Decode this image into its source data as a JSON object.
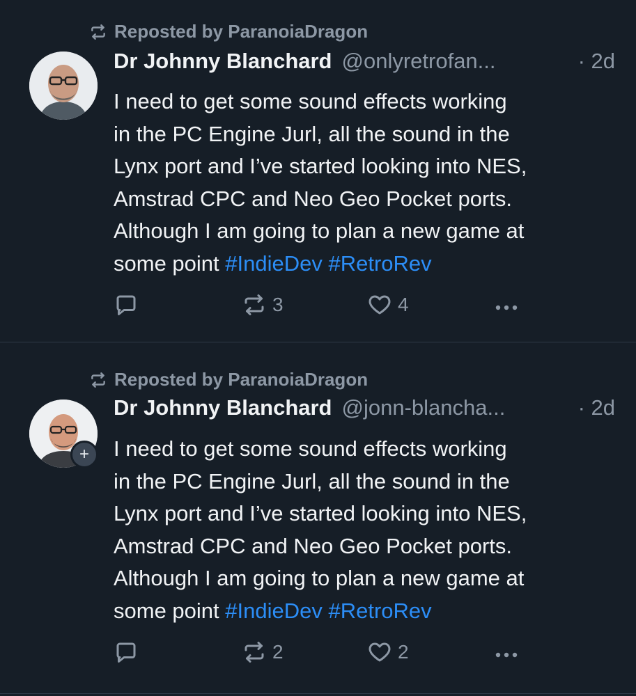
{
  "posts": [
    {
      "repost_label": "Reposted by ParanoiaDragon",
      "author": "Dr Johnny Blanchard",
      "handle": "@onlyretrofan...",
      "time": "· 2d",
      "text_lines": [
        "I need to get some sound effects working",
        "in the PC Engine Jurl, all the sound in the",
        "Lynx port and I’ve started looking into NES,",
        "Amstrad CPC and Neo Geo Pocket ports.",
        "Although I am going to plan a new game at",
        "some point "
      ],
      "hashtags": [
        "#IndieDev",
        "#RetroRev"
      ],
      "repost_count": "3",
      "like_count": "4",
      "follow_badge": ""
    },
    {
      "repost_label": "Reposted by ParanoiaDragon",
      "author": "Dr Johnny Blanchard",
      "handle": "@jonn-blancha...",
      "time": "· 2d",
      "text_lines": [
        "I need to get some sound effects working",
        "in the PC Engine Jurl, all the sound in the",
        "Lynx port and I’ve started looking into NES,",
        "Amstrad CPC and Neo Geo Pocket ports.",
        "Although I am going to plan a new game at",
        "some point "
      ],
      "hashtags": [
        "#IndieDev",
        "#RetroRev"
      ],
      "repost_count": "2",
      "like_count": "2",
      "follow_badge": "+"
    }
  ],
  "colors": {
    "background": "#161e27",
    "text": "#f1f3f5",
    "muted": "#8d98a5",
    "link": "#2c8ef7"
  },
  "icons": {
    "repost": "repost-icon",
    "reply": "reply-icon",
    "like": "heart-icon",
    "more": "more-icon"
  }
}
